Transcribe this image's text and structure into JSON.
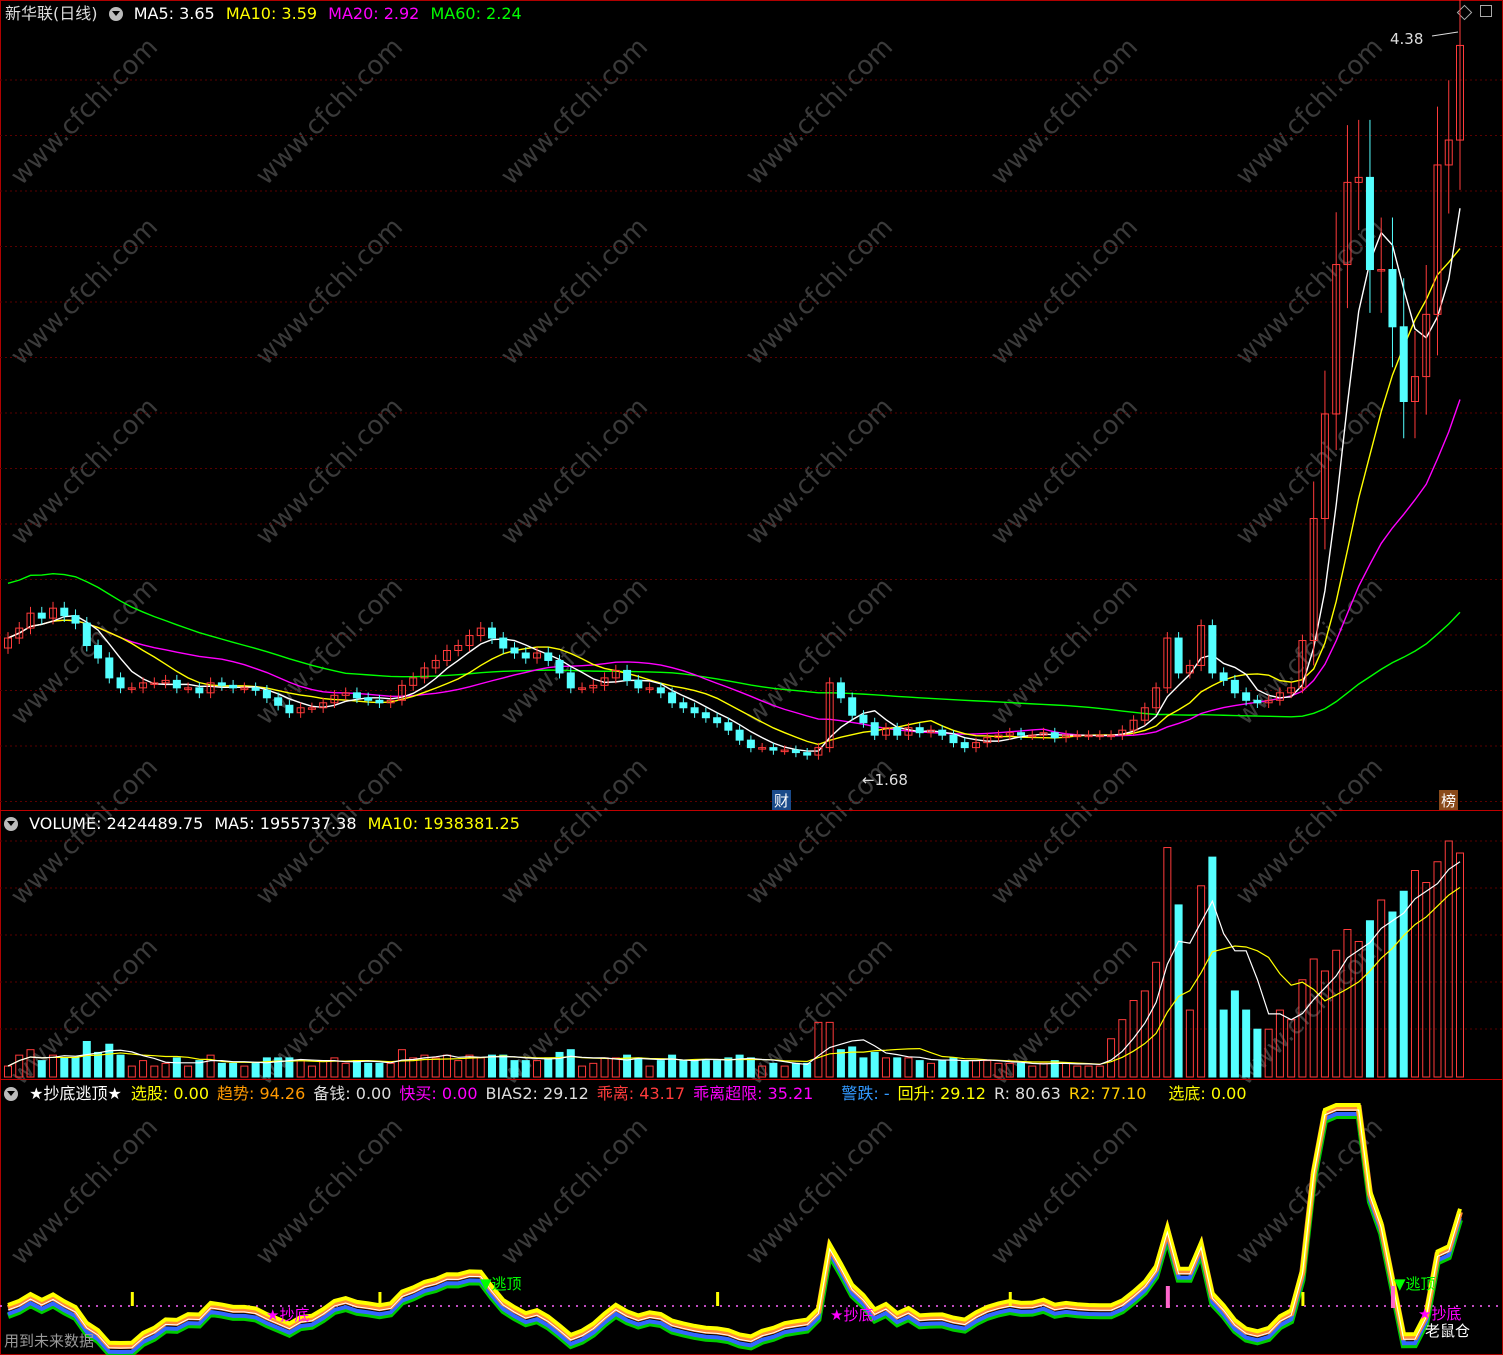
{
  "main_header": {
    "title": "新华联(日线)",
    "ma5_label": "MA5:",
    "ma5_value": "3.65",
    "ma10_label": "MA10:",
    "ma10_value": "3.59",
    "ma20_label": "MA20:",
    "ma20_value": "2.92",
    "ma60_label": "MA60:",
    "ma60_value": "2.24"
  },
  "main_annotations": {
    "high": "4.38",
    "low": "←1.68",
    "cai": "财",
    "bang": "榜"
  },
  "volume_header": {
    "volume_label": "VOLUME:",
    "volume_value": "2424489.75",
    "ma5_label": "MA5:",
    "ma5_value": "1955737.38",
    "ma10_label": "MA10:",
    "ma10_value": "1938381.25"
  },
  "indicator_header": {
    "title": "★抄底逃顶★",
    "items": [
      {
        "label": "选股:",
        "value": "0.00",
        "color": "#ffff00"
      },
      {
        "label": "趋势:",
        "value": "94.26",
        "color": "#ff9900"
      },
      {
        "label": "备钱:",
        "value": "0.00",
        "color": "#dddddd"
      },
      {
        "label": "快买:",
        "value": "0.00",
        "color": "#ff00ff"
      },
      {
        "label": "BIAS2:",
        "value": "29.12",
        "color": "#dddddd"
      },
      {
        "label": "乖离:",
        "value": "43.17",
        "color": "#ff3b3b"
      },
      {
        "label": "乖离超限:",
        "value": "35.21",
        "color": "#ff00ff"
      },
      {
        "label": "警跌:",
        "value": "-",
        "color": "#3399ff"
      },
      {
        "label": "回升:",
        "value": "29.12",
        "color": "#ffff00"
      },
      {
        "label": "R:",
        "value": "80.63",
        "color": "#dddddd"
      },
      {
        "label": "R2:",
        "value": "77.10",
        "color": "#ffcc00"
      },
      {
        "label": "选底:",
        "value": "0.00",
        "color": "#ffff00"
      }
    ]
  },
  "indicator_labels": {
    "escape_top_1": "▼逃顶",
    "escape_top_2": "▼逃顶",
    "bottom_1": "★抄底",
    "bottom_2": "★抄底",
    "bottom_3": "★抄底"
  },
  "footer": {
    "future_data": "用到未来数据",
    "brand": "老鼠仓"
  },
  "watermark": "www.cfchi.com",
  "colors": {
    "up": "#ff3b3b",
    "down": "#54ffff",
    "ma5": "#ffffff",
    "ma10": "#ffff00",
    "ma20": "#ff00ff",
    "ma60": "#00ff00",
    "border": "#c00000"
  },
  "chart_data": {
    "type": "candlestick",
    "price_range": [
      1.68,
      4.38
    ],
    "close": [
      2.0,
      2.04,
      2.1,
      2.08,
      2.12,
      2.09,
      2.06,
      1.97,
      1.92,
      1.84,
      1.8,
      1.8,
      1.82,
      1.82,
      1.83,
      1.8,
      1.8,
      1.78,
      1.82,
      1.81,
      1.8,
      1.8,
      1.79,
      1.76,
      1.73,
      1.7,
      1.72,
      1.72,
      1.74,
      1.77,
      1.78,
      1.76,
      1.75,
      1.74,
      1.75,
      1.81,
      1.84,
      1.88,
      1.91,
      1.95,
      1.97,
      2.01,
      2.04,
      2.0,
      1.96,
      1.94,
      1.92,
      1.94,
      1.91,
      1.86,
      1.8,
      1.8,
      1.81,
      1.84,
      1.87,
      1.83,
      1.8,
      1.8,
      1.78,
      1.74,
      1.72,
      1.7,
      1.68,
      1.66,
      1.63,
      1.59,
      1.56,
      1.56,
      1.55,
      1.55,
      1.54,
      1.53,
      1.56,
      1.82,
      1.76,
      1.69,
      1.66,
      1.61,
      1.64,
      1.61,
      1.64,
      1.62,
      1.63,
      1.61,
      1.58,
      1.56,
      1.58,
      1.6,
      1.61,
      1.62,
      1.61,
      1.61,
      1.62,
      1.6,
      1.61,
      1.61,
      1.61,
      1.61,
      1.61,
      1.63,
      1.67,
      1.72,
      1.8,
      2.0,
      1.86,
      1.89,
      2.05,
      1.86,
      1.83,
      1.78,
      1.75,
      1.74,
      1.75,
      1.78,
      1.8,
      1.99,
      2.48,
      2.9,
      3.5,
      3.83,
      3.85,
      3.48,
      3.48,
      3.25,
      2.95,
      3.05,
      3.3,
      3.9,
      4.0,
      4.38
    ]
  }
}
